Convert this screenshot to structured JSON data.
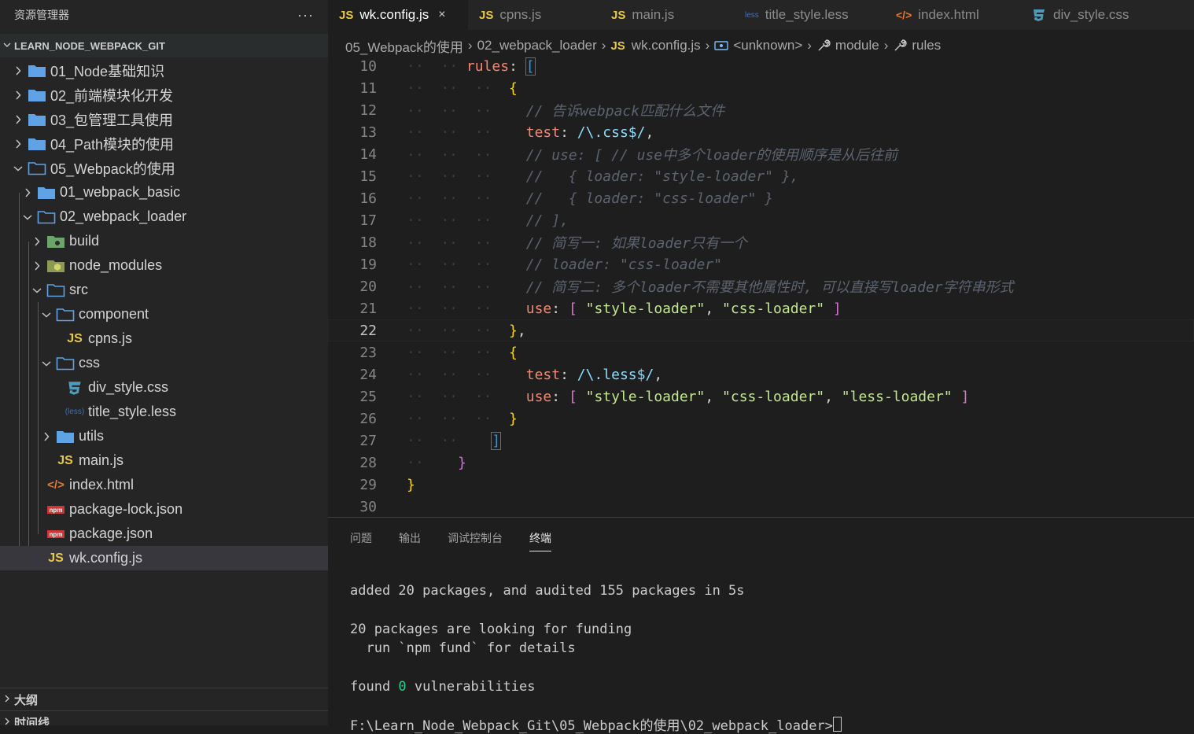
{
  "sidebar": {
    "title": "资源管理器",
    "more": "···",
    "workspace": "LEARN_NODE_WEBPACK_GIT",
    "tree": [
      {
        "label": "01_Node基础知识"
      },
      {
        "label": "02_前端模块化开发"
      },
      {
        "label": "03_包管理工具使用"
      },
      {
        "label": "04_Path模块的使用"
      },
      {
        "label": "05_Webpack的使用"
      },
      {
        "label": "01_webpack_basic"
      },
      {
        "label": "02_webpack_loader"
      },
      {
        "label": "build"
      },
      {
        "label": "node_modules"
      },
      {
        "label": "src"
      },
      {
        "label": "component"
      },
      {
        "label": "cpns.js"
      },
      {
        "label": "css"
      },
      {
        "label": "div_style.css"
      },
      {
        "label": "title_style.less"
      },
      {
        "label": "utils"
      },
      {
        "label": "main.js"
      },
      {
        "label": "index.html"
      },
      {
        "label": "package-lock.json"
      },
      {
        "label": "package.json"
      },
      {
        "label": "wk.config.js"
      }
    ],
    "sections": [
      {
        "label": "大纲"
      },
      {
        "label": "时间线"
      }
    ]
  },
  "tabs": [
    {
      "icon_text": "JS",
      "label": "wk.config.js",
      "close": "×"
    },
    {
      "icon_text": "JS",
      "label": "cpns.js"
    },
    {
      "icon_text": "JS",
      "label": "main.js"
    },
    {
      "icon_text": "less",
      "label": "title_style.less"
    },
    {
      "icon_text": "</>",
      "label": "index.html"
    },
    {
      "icon_text": "",
      "label": "div_style.css"
    }
  ],
  "breadcrumb": {
    "items": [
      "05_Webpack的使用",
      "02_webpack_loader",
      "wk.config.js",
      "<unknown>",
      "module",
      "rules"
    ],
    "js_icon": "JS"
  },
  "code": {
    "line_numbers": [
      "10",
      "11",
      "12",
      "13",
      "14",
      "15",
      "16",
      "17",
      "18",
      "19",
      "20",
      "21",
      "22",
      "23",
      "24",
      "25",
      "26",
      "27",
      "28",
      "29",
      "30"
    ],
    "rules_key": "rules",
    "c12": "// 告诉webpack匹配什么文件",
    "c14": "// use: [ // use中多个loader的使用顺序是从后往前",
    "c15": "//   { loader: \"style-loader\" },",
    "c16": "//   { loader: \"css-loader\" }",
    "c17": "// ],",
    "c18": "// 简写一: 如果loader只有一个",
    "c19": "// loader: \"css-loader\"",
    "c20": "// 简写二: 多个loader不需要其他属性时, 可以直接写loader字符串形式",
    "test_key": "test",
    "use_key": "use",
    "css_regex": "/\\.css$/",
    "less_regex": "/\\.less$/",
    "style_loader": "\"style-loader\"",
    "css_loader": "\"css-loader\"",
    "less_loader": "\"less-loader\""
  },
  "panel": {
    "tabs": [
      "问题",
      "输出",
      "调试控制台",
      "终端"
    ],
    "terminal": {
      "line1": "added 20 packages, and audited 155 packages in 5s",
      "line2": "20 packages are looking for funding",
      "line3": "  run `npm fund` for details",
      "line4": "found 0 vulnerabilities",
      "prompt": "F:\\Learn_Node_Webpack_Git\\05_Webpack的使用\\02_webpack_loader>"
    }
  },
  "colors": {
    "folder": "#5fa3e6",
    "js": "#e8c84a",
    "html": "#e37933",
    "css": "#519aba",
    "less": "#3b6ec4",
    "npm": "#cb3837"
  }
}
